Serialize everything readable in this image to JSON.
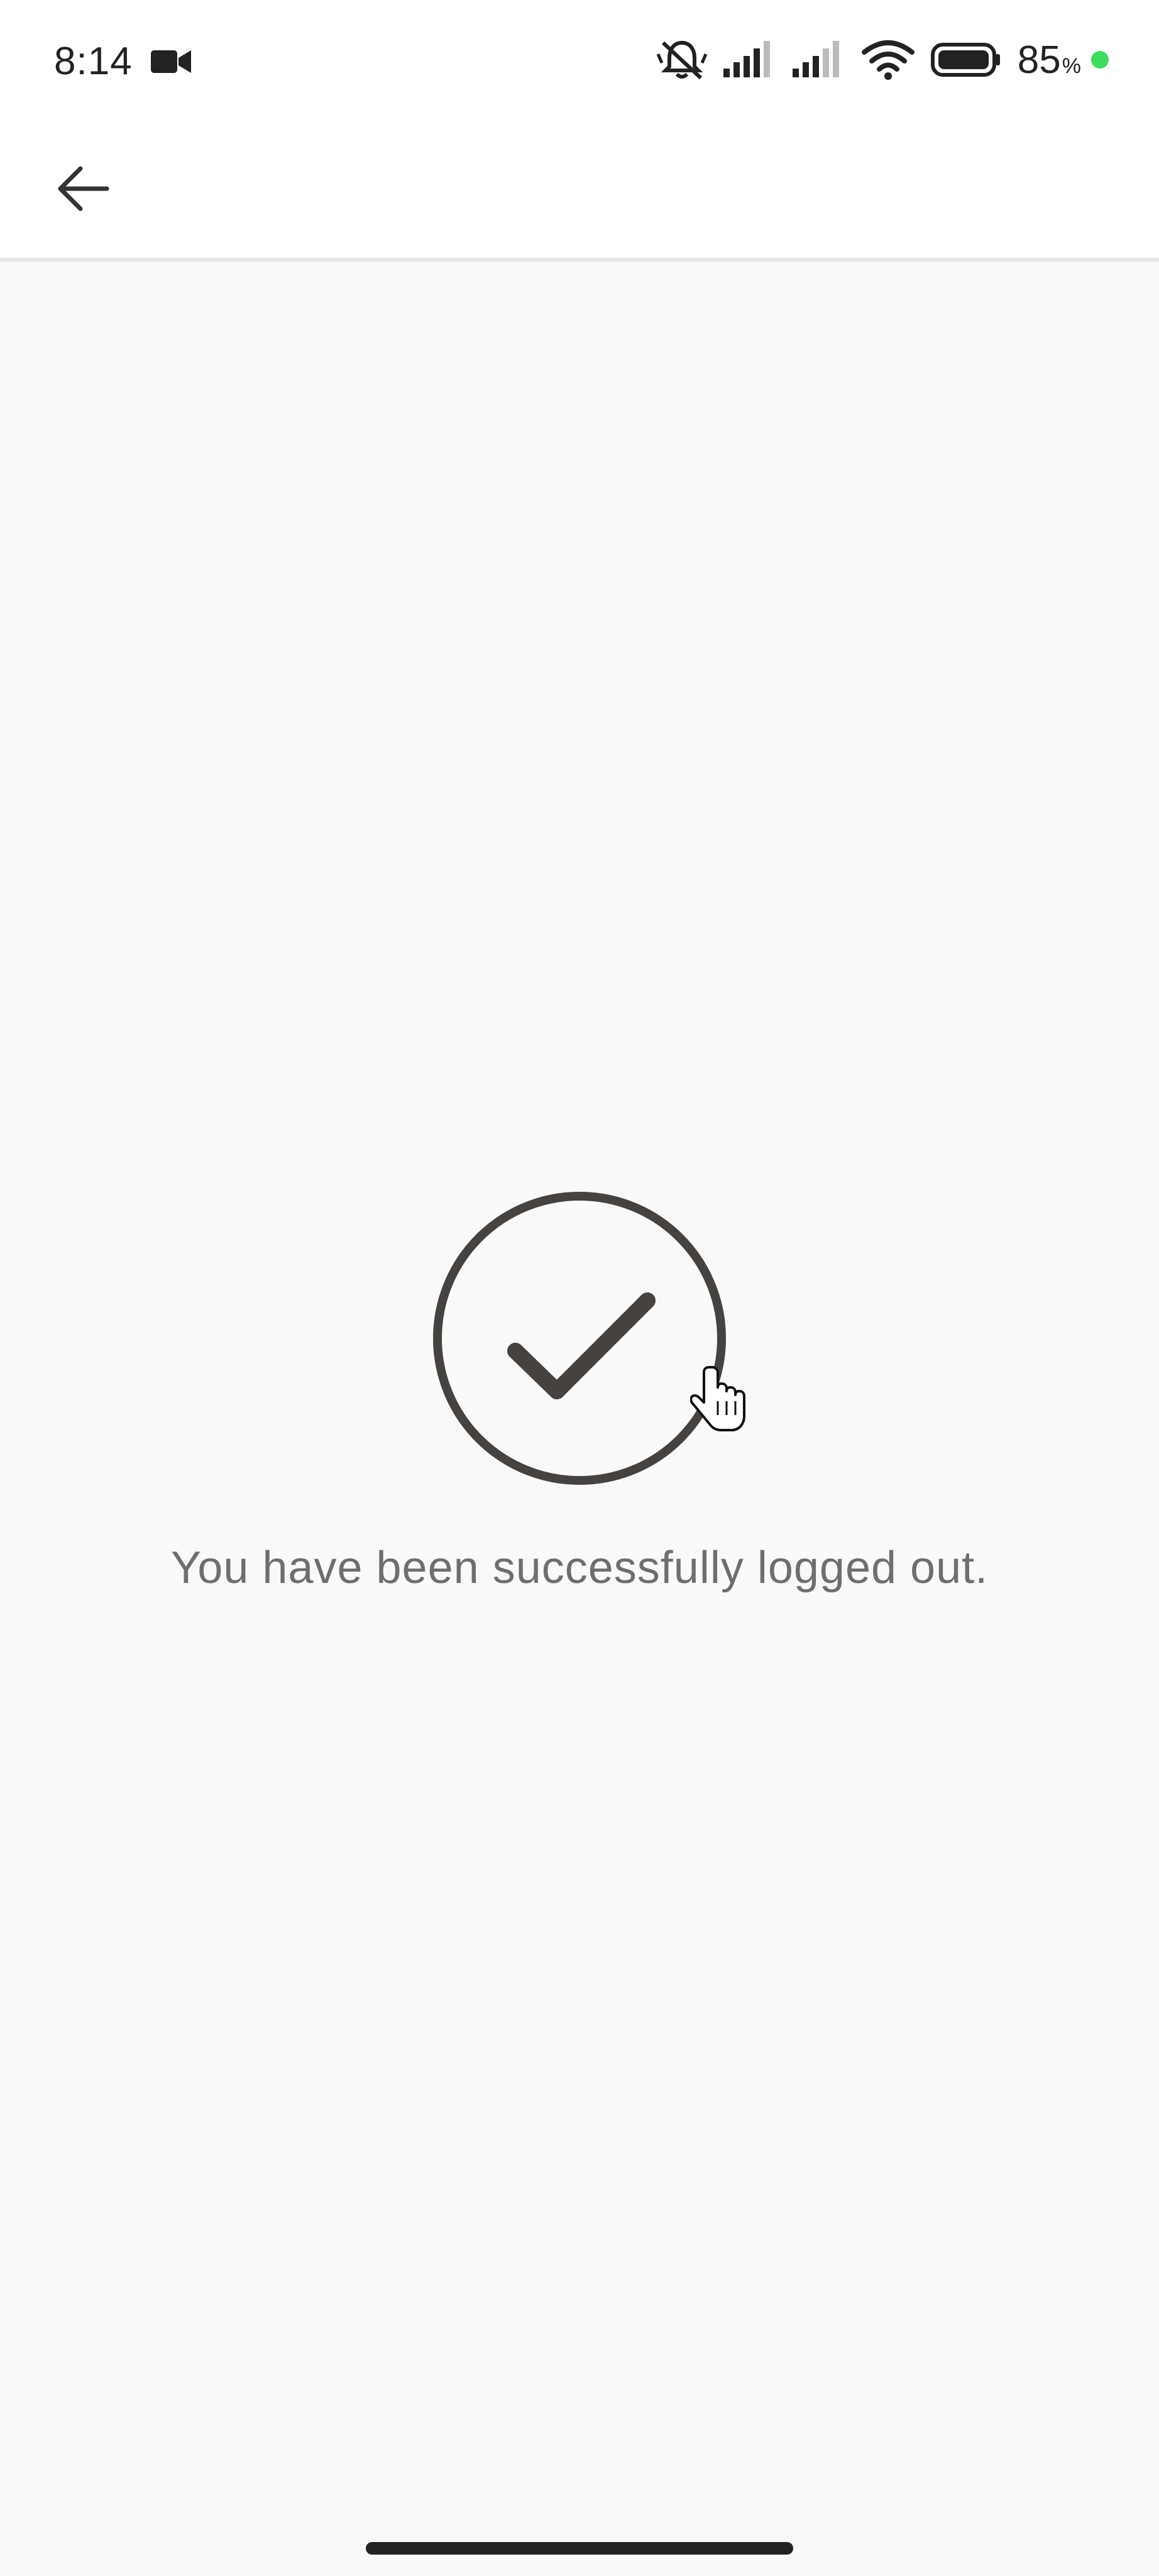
{
  "status_bar": {
    "time": "8:14",
    "battery_level": "85",
    "battery_unit": "%",
    "icons": [
      "video-camera-icon",
      "bell-muted-icon",
      "signal-icon",
      "signal-icon",
      "wifi-icon",
      "battery-icon"
    ],
    "charge_indicator_color": "#3ddc5a"
  },
  "app_bar": {
    "back_icon": "arrow-left-icon"
  },
  "main": {
    "status_icon": "check-circle-icon",
    "message": "You have been successfully logged out."
  },
  "colors": {
    "background": "#f9f9f9",
    "icon_stroke": "#454240",
    "message_text": "#6e6e6e"
  }
}
